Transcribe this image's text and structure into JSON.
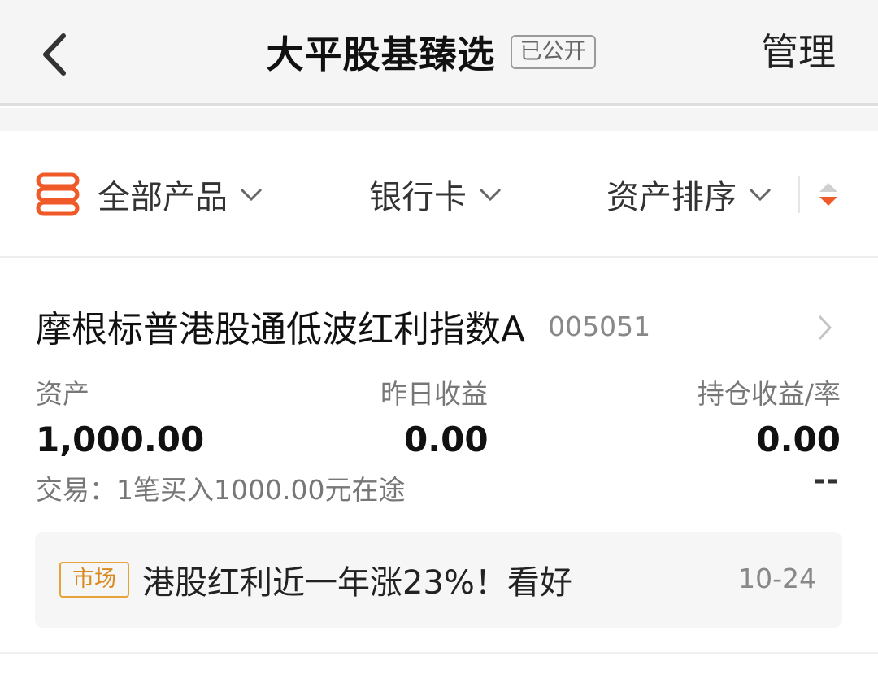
{
  "nav": {
    "title": "大平股基臻选",
    "badge": "已公开",
    "manage": "管理"
  },
  "filters": {
    "all_products": "全部产品",
    "bank_card": "银行卡",
    "asset_sort": "资产排序"
  },
  "fund": {
    "name": "摩根标普港股通低波红利指数A",
    "code": "005051",
    "metrics": {
      "asset_label": "资产",
      "asset_value": "1,000.00",
      "yesterday_label": "昨日收益",
      "yesterday_value": "0.00",
      "holding_label": "持仓收益/率",
      "holding_value": "0.00",
      "holding_rate": "--"
    },
    "trade_text": "交易：1笔买入1000.00元在途",
    "news": {
      "tag": "市场",
      "title": "港股红利近一年涨23%！看好",
      "date": "10-24"
    }
  },
  "colors": {
    "accent": "#f05a28",
    "tag_orange": "#d98a1e"
  },
  "icons": [
    "back-arrow-icon",
    "list-stack-icon",
    "chevron-down-icon",
    "sort-toggle-icon",
    "chevron-right-icon"
  ]
}
